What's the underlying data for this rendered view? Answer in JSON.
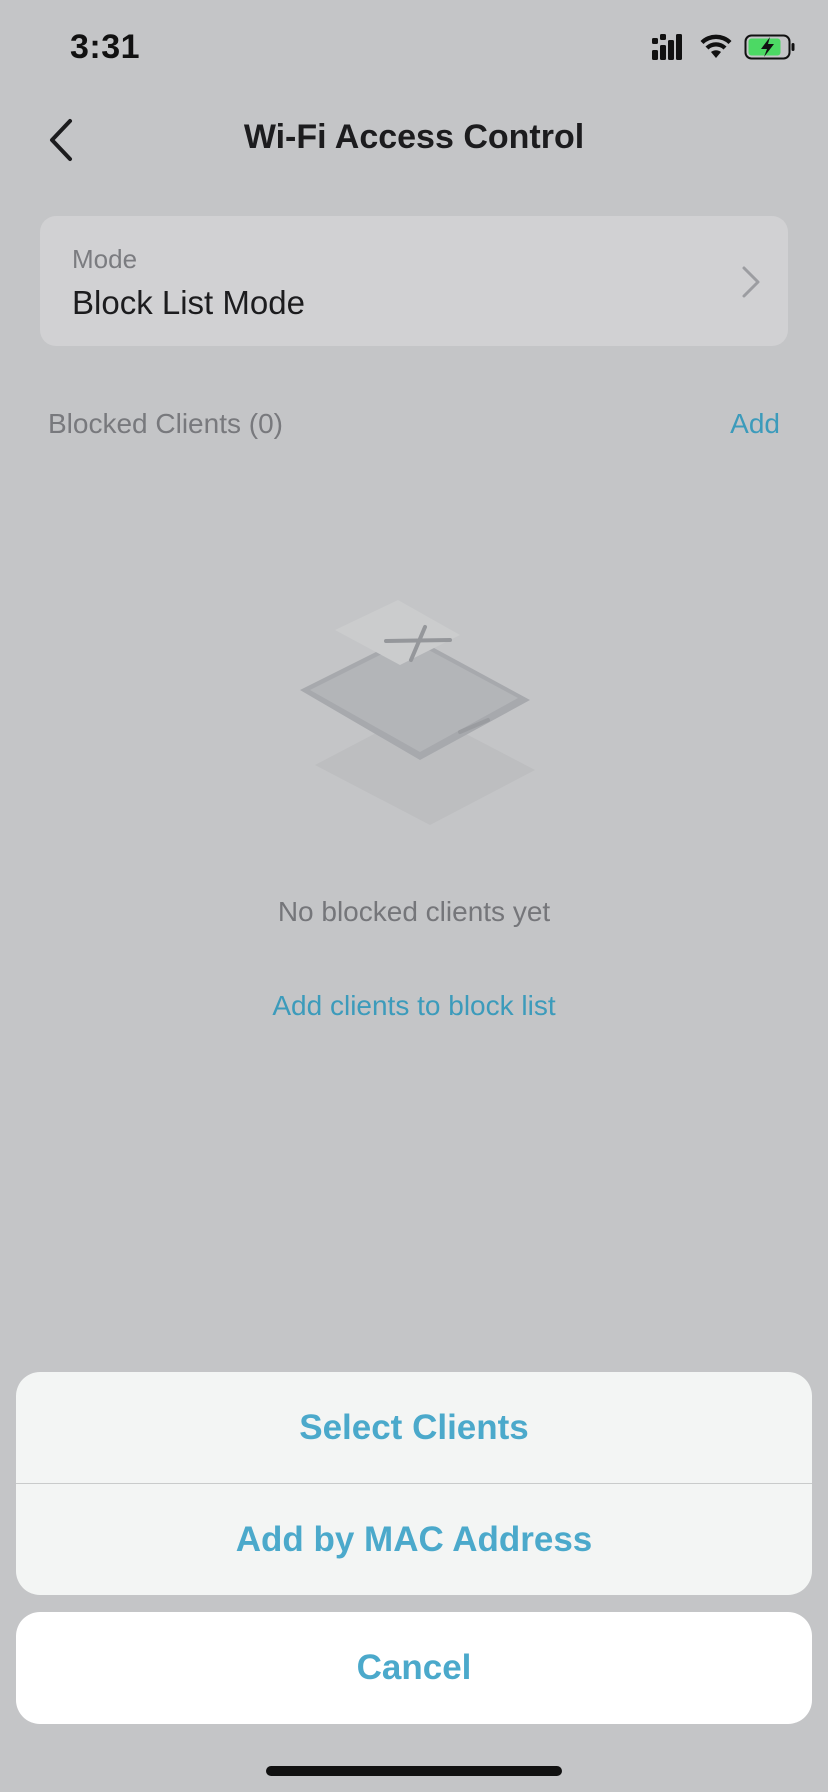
{
  "status_bar": {
    "time": "3:31"
  },
  "nav": {
    "title": "Wi-Fi Access Control"
  },
  "mode_card": {
    "label": "Mode",
    "value": "Block List Mode"
  },
  "blocked_section": {
    "title": "Blocked Clients (0)",
    "add_label": "Add"
  },
  "empty_state": {
    "message": "No blocked clients yet",
    "link": "Add clients to block list"
  },
  "action_sheet": {
    "options": [
      {
        "label": "Select Clients"
      },
      {
        "label": "Add by MAC Address"
      }
    ],
    "cancel_label": "Cancel"
  },
  "colors": {
    "accent": "#4ba9cb",
    "overlay_bg": "#c4c5c7",
    "battery_fill": "#4cd964"
  }
}
